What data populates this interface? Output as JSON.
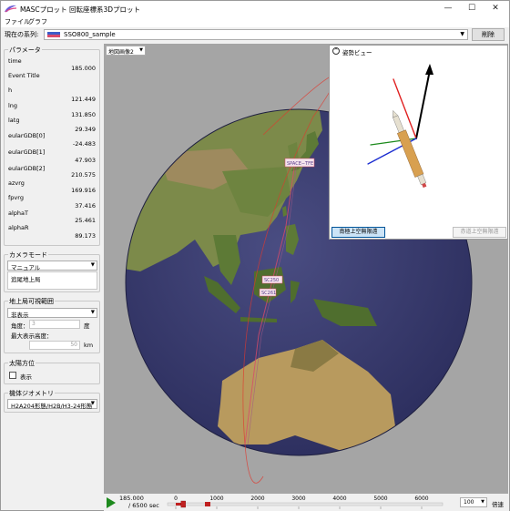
{
  "window": {
    "title": "MASCプロット 回転座標系3Dプロット",
    "controls": {
      "minimize": "—",
      "maximize": "☐",
      "close": "✕"
    }
  },
  "menu": {
    "items": [
      "ファイル",
      "グラフ"
    ]
  },
  "series": {
    "label": "現在の系列:",
    "value": "SSO800_sample",
    "delete_label": "削除"
  },
  "params": {
    "title": "パラメータ",
    "rows": [
      {
        "name": "time",
        "value": "185.000"
      },
      {
        "name": "Event Title",
        "value": ""
      },
      {
        "name": "h",
        "value": "121.449"
      },
      {
        "name": "lng",
        "value": "131.850"
      },
      {
        "name": "latg",
        "value": "29.349"
      },
      {
        "name": "eularGDB[0]",
        "value": "-24.483"
      },
      {
        "name": "eularGDB[1]",
        "value": "47.903"
      },
      {
        "name": "eularGDB[2]",
        "value": "210.575"
      },
      {
        "name": "azvrg",
        "value": "169.916"
      },
      {
        "name": "fpvrg",
        "value": "37.416"
      },
      {
        "name": "alphaT",
        "value": "25.461"
      },
      {
        "name": "alphaR",
        "value": "89.173"
      }
    ]
  },
  "camera": {
    "title": "カメラモード",
    "mode": "マニュアル",
    "list_item": "追尾地上局"
  },
  "ground": {
    "title": "地上局可視範囲",
    "display": "非表示",
    "angle_label": "角度：",
    "angle_value": "3",
    "angle_unit": "度",
    "maxalt_label": "最大表示高度：",
    "maxalt_value": "50",
    "maxalt_unit": "km"
  },
  "sun": {
    "title": "太陽方位",
    "checkbox_label": "表示"
  },
  "geometry": {
    "title": "機体ジオメトリ",
    "value": "H2A204形態/H2B/H3-24形態"
  },
  "view": {
    "map_select": "地図画像2",
    "marker_labels": [
      "SPACE−TFE",
      "SC250",
      "SC261"
    ]
  },
  "attitude": {
    "title": "姿勢ビュー",
    "btn_south": "南極上空無限遠",
    "btn_equator": "赤道上空無限遠"
  },
  "playback": {
    "current_time": "185.000",
    "total_time": "/ 6500 sec",
    "ticks": [
      "0",
      "1000",
      "2000",
      "3000",
      "4000",
      "5000",
      "6000"
    ],
    "progress": 0.0285,
    "speed": "100",
    "speed_label": "倍速"
  },
  "colors": {
    "accent": "#1e8a1e",
    "selected_button": "#cce4f7",
    "trajectory": "#e0382e",
    "ocean": "#3b3d6e"
  }
}
